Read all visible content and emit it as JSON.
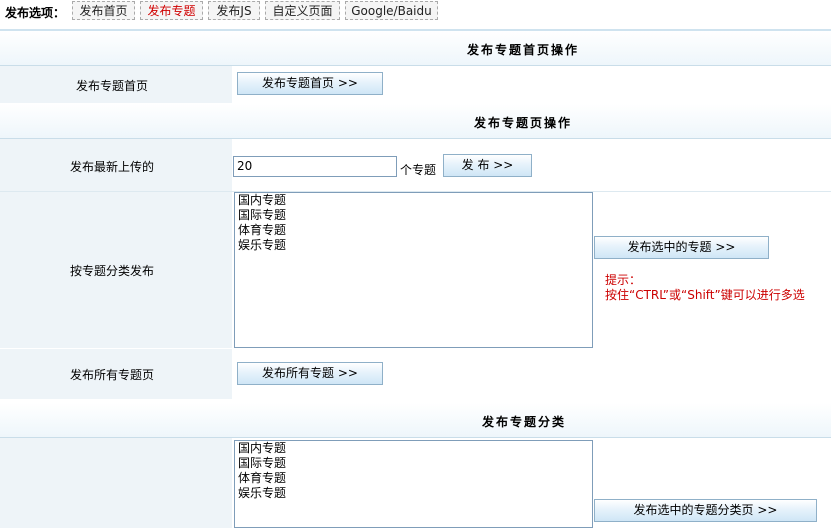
{
  "toolbar": {
    "label": "发布选项：",
    "tabs": [
      {
        "label": "发布首页",
        "active": false
      },
      {
        "label": "发布专题",
        "active": true
      },
      {
        "label": "发布JS",
        "active": false
      },
      {
        "label": "自定义页面",
        "active": false
      },
      {
        "label": "Google/Baidu",
        "active": false
      }
    ]
  },
  "section1": {
    "title": "发布专题首页操作",
    "row_label": "发布专题首页",
    "button": "发布专题首页 >>"
  },
  "section2": {
    "title": "发布专题页操作",
    "latest": {
      "label": "发布最新上传的",
      "value": "20",
      "unit": "个专题",
      "button": "发 布 >>"
    },
    "by_category": {
      "label": "按专题分类发布",
      "options": [
        "国内专题",
        "国际专题",
        "体育专题",
        "娱乐专题"
      ],
      "button": "发布选中的专题 >>",
      "tip_title": "提示：",
      "tip_text": "按住“CTRL”或“Shift”键可以进行多选"
    },
    "all": {
      "label": "发布所有专题页",
      "button": "发布所有专题 >>"
    }
  },
  "section3": {
    "title": "发布专题分类",
    "options": [
      "国内专题",
      "国际专题",
      "体育专题",
      "娱乐专题"
    ],
    "button": "发布选中的专题分类页 >>"
  }
}
